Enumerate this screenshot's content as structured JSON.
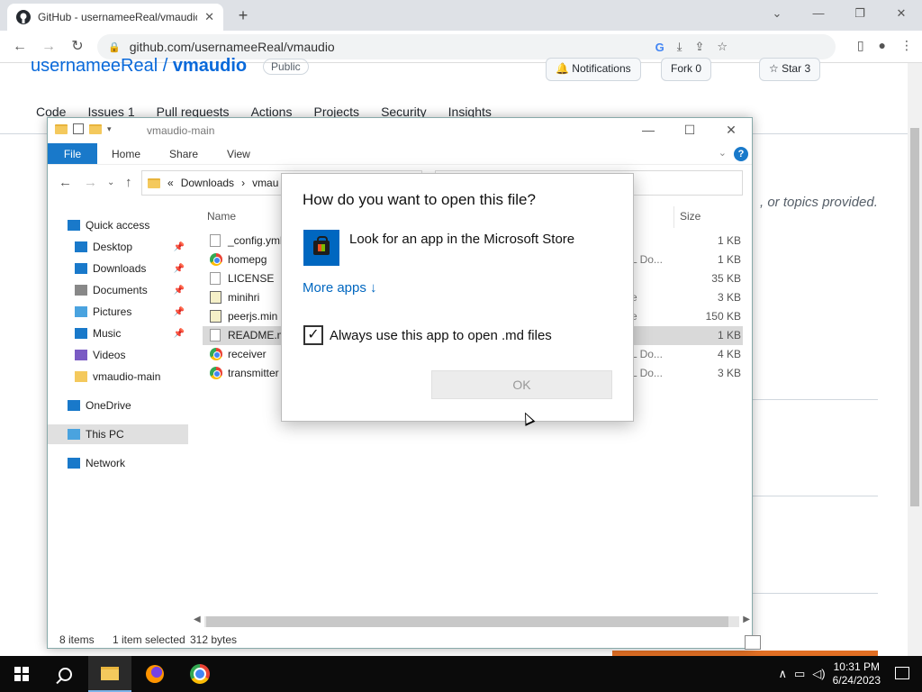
{
  "browser": {
    "tab_title": "GitHub - usernameeReal/vmaudio",
    "tab_close": "✕",
    "new_tab": "+",
    "url": "github.com/usernameeReal/vmaudio",
    "window_controls": [
      "⌄",
      "—",
      "❐",
      "✕"
    ]
  },
  "github": {
    "owner": "usernameeReal",
    "repo": "vmaudio",
    "visibility": "Public",
    "notifications_label": "Notifications",
    "fork_label": "Fork",
    "fork_count": "0",
    "star_label": "Star",
    "star_count": "3",
    "nav": [
      "Code",
      "Issues",
      "1",
      "Pull requests",
      "Actions",
      "Projects",
      "Security",
      "Insights"
    ],
    "about_text": ", or topics provided."
  },
  "explorer": {
    "title": "vmaudio-main",
    "ribbon_tabs": [
      "File",
      "Home",
      "Share",
      "View"
    ],
    "help": "?",
    "breadcrumb": [
      "«",
      "Downloads",
      "›",
      "vmau"
    ],
    "nav_items": [
      {
        "label": "Quick access",
        "icon": "star-icon",
        "pinned": false
      },
      {
        "label": "Desktop",
        "icon": "desktop-icon",
        "pinned": true
      },
      {
        "label": "Downloads",
        "icon": "download-icon",
        "pinned": true
      },
      {
        "label": "Documents",
        "icon": "documents-icon",
        "pinned": true
      },
      {
        "label": "Pictures",
        "icon": "pictures-icon",
        "pinned": true
      },
      {
        "label": "Music",
        "icon": "music-icon",
        "pinned": true
      },
      {
        "label": "Videos",
        "icon": "videos-icon",
        "pinned": false
      },
      {
        "label": "vmaudio-main",
        "icon": "folder-icon",
        "pinned": false
      },
      {
        "label": "OneDrive",
        "icon": "cloud-icon",
        "pinned": false
      },
      {
        "label": "This PC",
        "icon": "pc-icon",
        "pinned": false
      },
      {
        "label": "Network",
        "icon": "network-icon",
        "pinned": false
      }
    ],
    "columns": {
      "name": "Name",
      "size": "Size"
    },
    "files": [
      {
        "name": "_config.yml",
        "type": "",
        "size": "1 KB",
        "icon": "document-icon"
      },
      {
        "name": "homepg",
        "type": "L Do...",
        "size": "1 KB",
        "icon": "chrome-icon"
      },
      {
        "name": "LICENSE",
        "type": "",
        "size": "35 KB",
        "icon": "document-icon"
      },
      {
        "name": "minihri",
        "type": "e",
        "size": "3 KB",
        "icon": "script-icon"
      },
      {
        "name": "peerjs.min",
        "type": "e",
        "size": "150 KB",
        "icon": "script-icon"
      },
      {
        "name": "README.md",
        "type": "",
        "size": "1 KB",
        "icon": "document-icon",
        "selected": true
      },
      {
        "name": "receiver",
        "type": "L Do...",
        "size": "4 KB",
        "icon": "chrome-icon"
      },
      {
        "name": "transmitter",
        "type": "L Do...",
        "size": "3 KB",
        "icon": "chrome-icon"
      }
    ],
    "status": {
      "items": "8 items",
      "selected": "1 item selected",
      "bytes": "312 bytes"
    }
  },
  "dialog": {
    "heading": "How do you want to open this file?",
    "store_option": "Look for an app in the Microsoft Store",
    "more_apps": "More apps ↓",
    "checkbox_checked": true,
    "checkbox_label": "Always use this app to open .md files",
    "ok_label": "OK"
  },
  "taskbar": {
    "time": "10:31 PM",
    "date": "6/24/2023"
  }
}
